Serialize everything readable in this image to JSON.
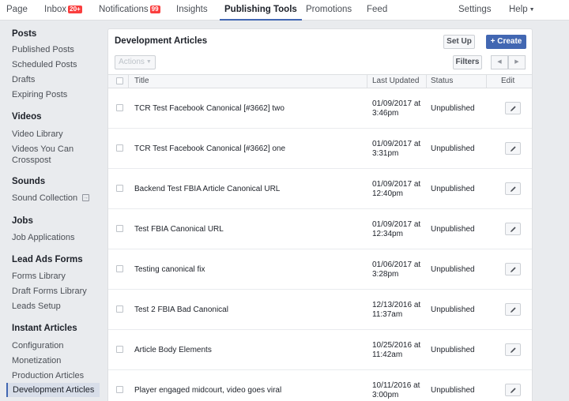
{
  "nav": {
    "items": [
      {
        "label": "Page"
      },
      {
        "label": "Inbox",
        "badge": "20+"
      },
      {
        "label": "Notifications",
        "badge": "99"
      },
      {
        "label": "Insights"
      },
      {
        "label": "Publishing Tools",
        "active": true
      },
      {
        "label": "Promotions"
      },
      {
        "label": "Feed"
      },
      {
        "label": "Settings"
      },
      {
        "label": "Help"
      }
    ]
  },
  "sidebar": {
    "sections": [
      {
        "heading": "Posts",
        "items": [
          "Published Posts",
          "Scheduled Posts",
          "Drafts",
          "Expiring Posts"
        ]
      },
      {
        "heading": "Videos",
        "items": [
          "Video Library",
          "Videos You Can Crosspost"
        ]
      },
      {
        "heading": "Sounds",
        "items": [
          "Sound Collection"
        ]
      },
      {
        "heading": "Jobs",
        "items": [
          "Job Applications"
        ]
      },
      {
        "heading": "Lead Ads Forms",
        "items": [
          "Forms Library",
          "Draft Forms Library",
          "Leads Setup"
        ]
      },
      {
        "heading": "Instant Articles",
        "items": [
          "Configuration",
          "Monetization",
          "Production Articles",
          "Development Articles"
        ]
      }
    ],
    "active_item": "Development Articles"
  },
  "panel": {
    "title": "Development Articles",
    "setup_label": "Set Up",
    "create_label": "Create",
    "actions_label": "Actions",
    "filters_label": "Filters"
  },
  "table": {
    "columns": [
      "Title",
      "Last Updated",
      "Status",
      "Edit"
    ],
    "rows": [
      {
        "title": "TCR Test Facebook Canonical [#3662] two",
        "date": "01/09/2017 at",
        "time": "3:46pm",
        "status": "Unpublished"
      },
      {
        "title": "TCR Test Facebook Canonical [#3662] one",
        "date": "01/09/2017 at",
        "time": "3:31pm",
        "status": "Unpublished"
      },
      {
        "title": "Backend Test FBIA Article Canonical URL",
        "date": "01/09/2017 at",
        "time": "12:40pm",
        "status": "Unpublished"
      },
      {
        "title": "Test FBIA Canonical URL",
        "date": "01/09/2017 at",
        "time": "12:34pm",
        "status": "Unpublished"
      },
      {
        "title": "Testing canonical fix",
        "date": "01/06/2017 at",
        "time": "3:28pm",
        "status": "Unpublished"
      },
      {
        "title": "Test 2 FBIA Bad Canonical",
        "date": "12/13/2016 at",
        "time": "11:37am",
        "status": "Unpublished"
      },
      {
        "title": "Article Body Elements",
        "date": "10/25/2016 at",
        "time": "11:42am",
        "status": "Unpublished"
      },
      {
        "title": "Player engaged midcourt, video goes viral",
        "date": "10/11/2016 at",
        "time": "3:00pm",
        "status": "Unpublished"
      }
    ]
  },
  "colors": {
    "accent": "#4267b2",
    "badge": "#fa3e3e"
  }
}
